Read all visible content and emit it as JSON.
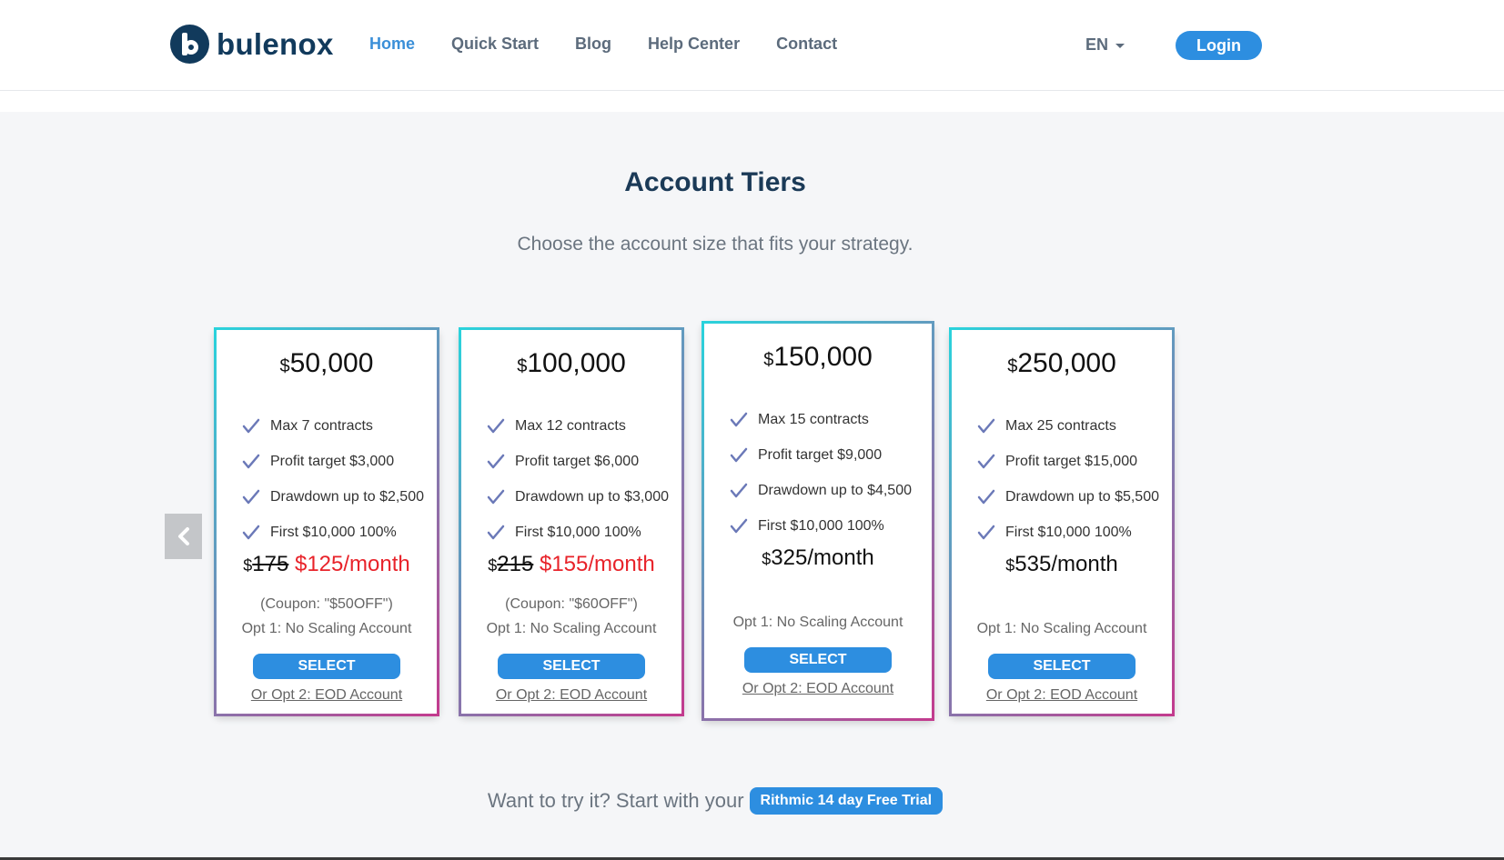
{
  "header": {
    "logo_text": "bulenox",
    "nav": [
      "Home",
      "Quick Start",
      "Blog",
      "Help Center",
      "Contact"
    ],
    "language": "EN",
    "login_label": "Login"
  },
  "section": {
    "title": "Account Tiers",
    "subtitle": "Choose the account size that fits your strategy."
  },
  "currency_symbol": "$",
  "cards": [
    {
      "amount": "50,000",
      "features": [
        "Max 7 contracts",
        "Profit target $3,000",
        "Drawdown up to $2,500",
        "First $10,000 100%"
      ],
      "old_price": "175",
      "new_price": "$125/month",
      "coupon": "(Coupon: \"$50OFF\")",
      "opt1": "Opt 1: No Scaling Account",
      "select_label": "SELECT",
      "opt2": "Or Opt 2: EOD Account"
    },
    {
      "amount": "100,000",
      "features": [
        "Max 12 contracts",
        "Profit target $6,000",
        "Drawdown up to $3,000",
        "First $10,000 100%"
      ],
      "old_price": "215",
      "new_price": "$155/month",
      "coupon": "(Coupon: \"$60OFF\")",
      "opt1": "Opt 1: No Scaling Account",
      "select_label": "SELECT",
      "opt2": "Or Opt 2: EOD Account"
    },
    {
      "amount": "150,000",
      "features": [
        "Max 15 contracts",
        "Profit target $9,000",
        "Drawdown up to $4,500",
        "First $10,000 100%"
      ],
      "price": "325/month",
      "opt1": "Opt 1: No Scaling Account",
      "select_label": "SELECT",
      "opt2": "Or Opt 2: EOD Account"
    },
    {
      "amount": "250,000",
      "features": [
        "Max 25 contracts",
        "Profit target $15,000",
        "Drawdown up to $5,500",
        "First $10,000 100%"
      ],
      "price": "535/month",
      "opt1": "Opt 1: No Scaling Account",
      "select_label": "SELECT",
      "opt2": "Or Opt 2: EOD Account"
    }
  ],
  "trial": {
    "text": "Want to try it? Start with your",
    "button_label": "Rithmic 14 day Free Trial"
  },
  "colors": {
    "accent": "#2d8ee0",
    "brand": "#113a5c",
    "discount": "#e8232a",
    "card_gradient_start": "#29d3dc",
    "card_gradient_end": "#c33b8e"
  },
  "icons": {
    "prev": "chevron-left-icon",
    "feature": "check-icon",
    "language": "caret-down-icon"
  }
}
